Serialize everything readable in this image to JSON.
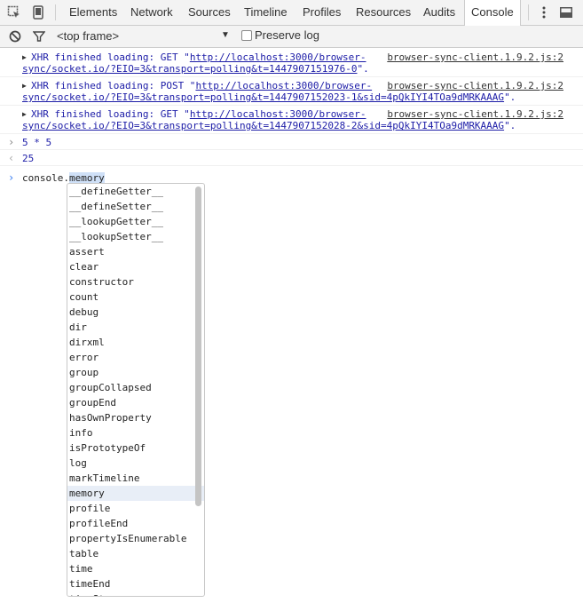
{
  "tabs": [
    "Elements",
    "Network",
    "Sources",
    "Timeline",
    "Profiles",
    "Resources",
    "Audits",
    "Console"
  ],
  "active_tab": "Console",
  "toolbar": {
    "frame_select": "<top frame>",
    "preserve_log_label": "Preserve log"
  },
  "messages": [
    {
      "prefix": "XHR finished loading: GET \"",
      "url1": "http://localhost:3000/browser-",
      "url2": "sync/socket.io/?EIO=3&transport=polling&t=1447907151976-0",
      "suffix": "\".",
      "source": "browser-sync-client.1.9.2.js:2"
    },
    {
      "prefix": "XHR finished loading: POST \"",
      "url1": "http://localhost:3000/browser-",
      "url2": "sync/socket.io/?EIO=3&transport=polling&t=1447907152023-1&sid=4pQkIYI4TOa9dMRKAAAG",
      "suffix": "\".",
      "source": "browser-sync-client.1.9.2.js:2"
    },
    {
      "prefix": "XHR finished loading: GET \"",
      "url1": "http://localhost:3000/browser-",
      "url2": "sync/socket.io/?EIO=3&transport=polling&t=1447907152028-2&sid=4pQkIYI4TOa9dMRKAAAG",
      "suffix": "\".",
      "source": "browser-sync-client.1.9.2.js:2"
    }
  ],
  "eval": {
    "input": "5 * 5",
    "output": "25"
  },
  "prompt": {
    "before": "console.",
    "selected": "memory"
  },
  "suggestions": [
    "__defineGetter__",
    "__defineSetter__",
    "__lookupGetter__",
    "__lookupSetter__",
    "assert",
    "clear",
    "constructor",
    "count",
    "debug",
    "dir",
    "dirxml",
    "error",
    "group",
    "groupCollapsed",
    "groupEnd",
    "hasOwnProperty",
    "info",
    "isPrototypeOf",
    "log",
    "markTimeline",
    "memory",
    "profile",
    "profileEnd",
    "propertyIsEnumerable",
    "table",
    "time",
    "timeEnd",
    "timeStamp"
  ],
  "selected_suggestion": "memory",
  "colors": {
    "accent": "#367cf1",
    "link": "#1c1ca7",
    "selection": "#cfe0f7"
  }
}
